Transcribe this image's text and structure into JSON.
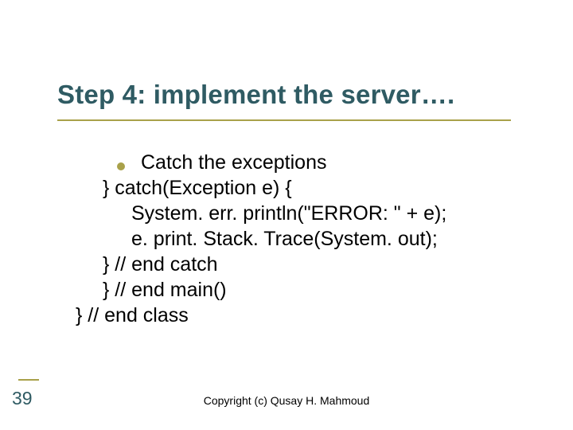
{
  "title": "Step 4: implement the server….",
  "bullet": "Catch the exceptions",
  "code": {
    "l1": "} catch(Exception e) {",
    "l2": "System. err. println(\"ERROR: \" + e);",
    "l3": "e. print. Stack. Trace(System. out);",
    "l4": "} // end catch",
    "l5": "} // end main()",
    "l6": "} // end class"
  },
  "page_number": "39",
  "footer": "Copyright (c) Qusay H. Mahmoud"
}
